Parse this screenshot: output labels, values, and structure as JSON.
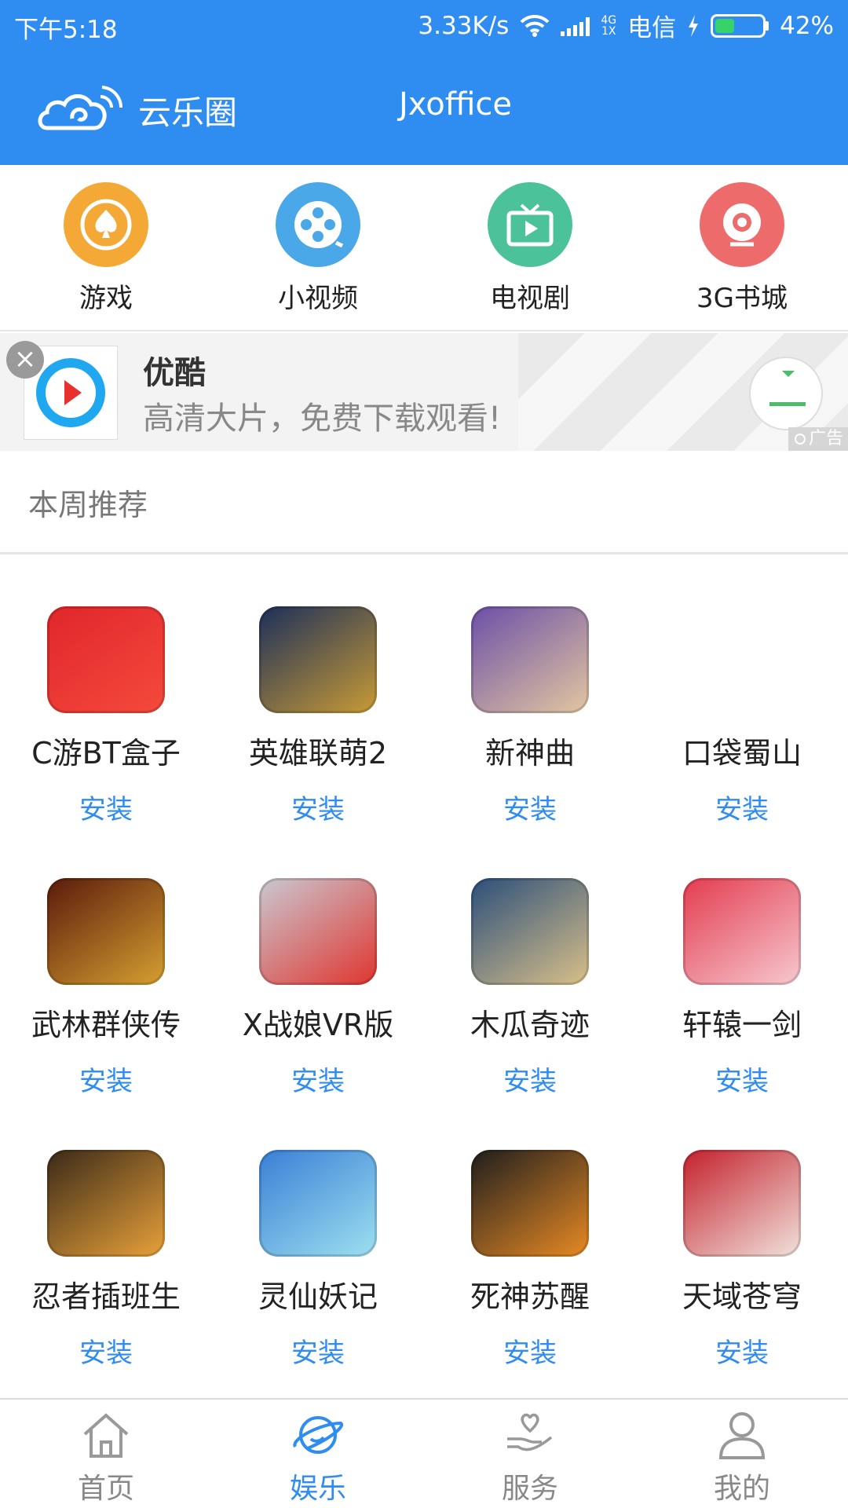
{
  "status_bar": {
    "time": "下午5:18",
    "speed": "3.33K/s",
    "network_top": "4G",
    "network_bottom": "1X",
    "carrier": "电信",
    "battery": "42%",
    "battery_level": 0.42
  },
  "header": {
    "brand_name": "云乐圈",
    "title": "Jxoffice",
    "background_color": "#2f8cf0"
  },
  "categories": [
    {
      "label": "游戏",
      "icon": "spade-icon",
      "color": "#f4a835"
    },
    {
      "label": "小视频",
      "icon": "film-reel-icon",
      "color": "#4aa8e8"
    },
    {
      "label": "电视剧",
      "icon": "tv-icon",
      "color": "#4cc29a"
    },
    {
      "label": "3G书城",
      "icon": "camera-lens-icon",
      "color": "#ee6b6b"
    }
  ],
  "ad": {
    "title": "优酷",
    "subtitle": "高清大片，免费下载观看!",
    "tag": "广告",
    "close": "×"
  },
  "section": {
    "title": "本周推荐"
  },
  "install_label": "安装",
  "apps": [
    {
      "name": "C游BT盒子",
      "color1": "#e0262b",
      "color2": "#f54a3c"
    },
    {
      "name": "英雄联萌2",
      "color1": "#1c2f5a",
      "color2": "#c89b36"
    },
    {
      "name": "新神曲",
      "color1": "#6b4fa8",
      "color2": "#e3c7a0"
    },
    {
      "name": "口袋蜀山",
      "color1": "#ffffff",
      "color2": "#ffffff"
    },
    {
      "name": "武林群侠传",
      "color1": "#5a1a0c",
      "color2": "#d6a031"
    },
    {
      "name": "X战娘VR版",
      "color1": "#c9c9d2",
      "color2": "#e0352f"
    },
    {
      "name": "木瓜奇迹",
      "color1": "#2b4f7a",
      "color2": "#d9c08a"
    },
    {
      "name": "轩辕一剑",
      "color1": "#e33c4f",
      "color2": "#f7c8d0"
    },
    {
      "name": "忍者插班生",
      "color1": "#3a2a18",
      "color2": "#e8a13a"
    },
    {
      "name": "灵仙妖记",
      "color1": "#3a7fd6",
      "color2": "#9de0f0"
    },
    {
      "name": "死神苏醒",
      "color1": "#1e1e1e",
      "color2": "#e88a24"
    },
    {
      "name": "天域苍穹",
      "color1": "#c4202c",
      "color2": "#f1e2dc"
    }
  ],
  "nav": [
    {
      "label": "首页",
      "icon": "home-icon"
    },
    {
      "label": "娱乐",
      "icon": "planet-icon",
      "active": true
    },
    {
      "label": "服务",
      "icon": "hand-heart-icon"
    },
    {
      "label": "我的",
      "icon": "person-icon"
    }
  ]
}
